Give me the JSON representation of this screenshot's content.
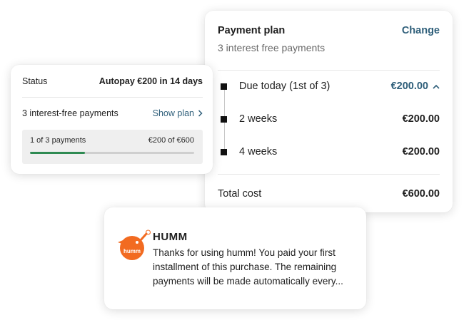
{
  "status_card": {
    "status_label": "Status",
    "status_value": "Autopay €200 in 14 days",
    "payments_label": "3 interest-free payments",
    "show_plan_label": "Show plan",
    "progress_label": "1 of 3 payments",
    "progress_amount": "€200 of €600",
    "progress_fraction": 0.333,
    "progress_color": "#2e8a52"
  },
  "plan_card": {
    "title": "Payment plan",
    "change_label": "Change",
    "subtitle": "3 interest free payments",
    "payments": [
      {
        "label": "Due today (1st of 3)",
        "amount": "€200.00",
        "accent": true
      },
      {
        "label": "2 weeks",
        "amount": "€200.00",
        "accent": false
      },
      {
        "label": "4 weeks",
        "amount": "€200.00",
        "accent": false
      }
    ],
    "total_label": "Total cost",
    "total_amount": "€600.00",
    "accent_color": "#2f5f7a"
  },
  "notification": {
    "logo_icon": "humm-bird-logo-icon",
    "logo_text": "humm",
    "logo_color": "#f26b21",
    "title": "HUMM",
    "body": "Thanks for using humm! You paid your first installment of this purchase. The remaining payments will be made automatically every..."
  }
}
